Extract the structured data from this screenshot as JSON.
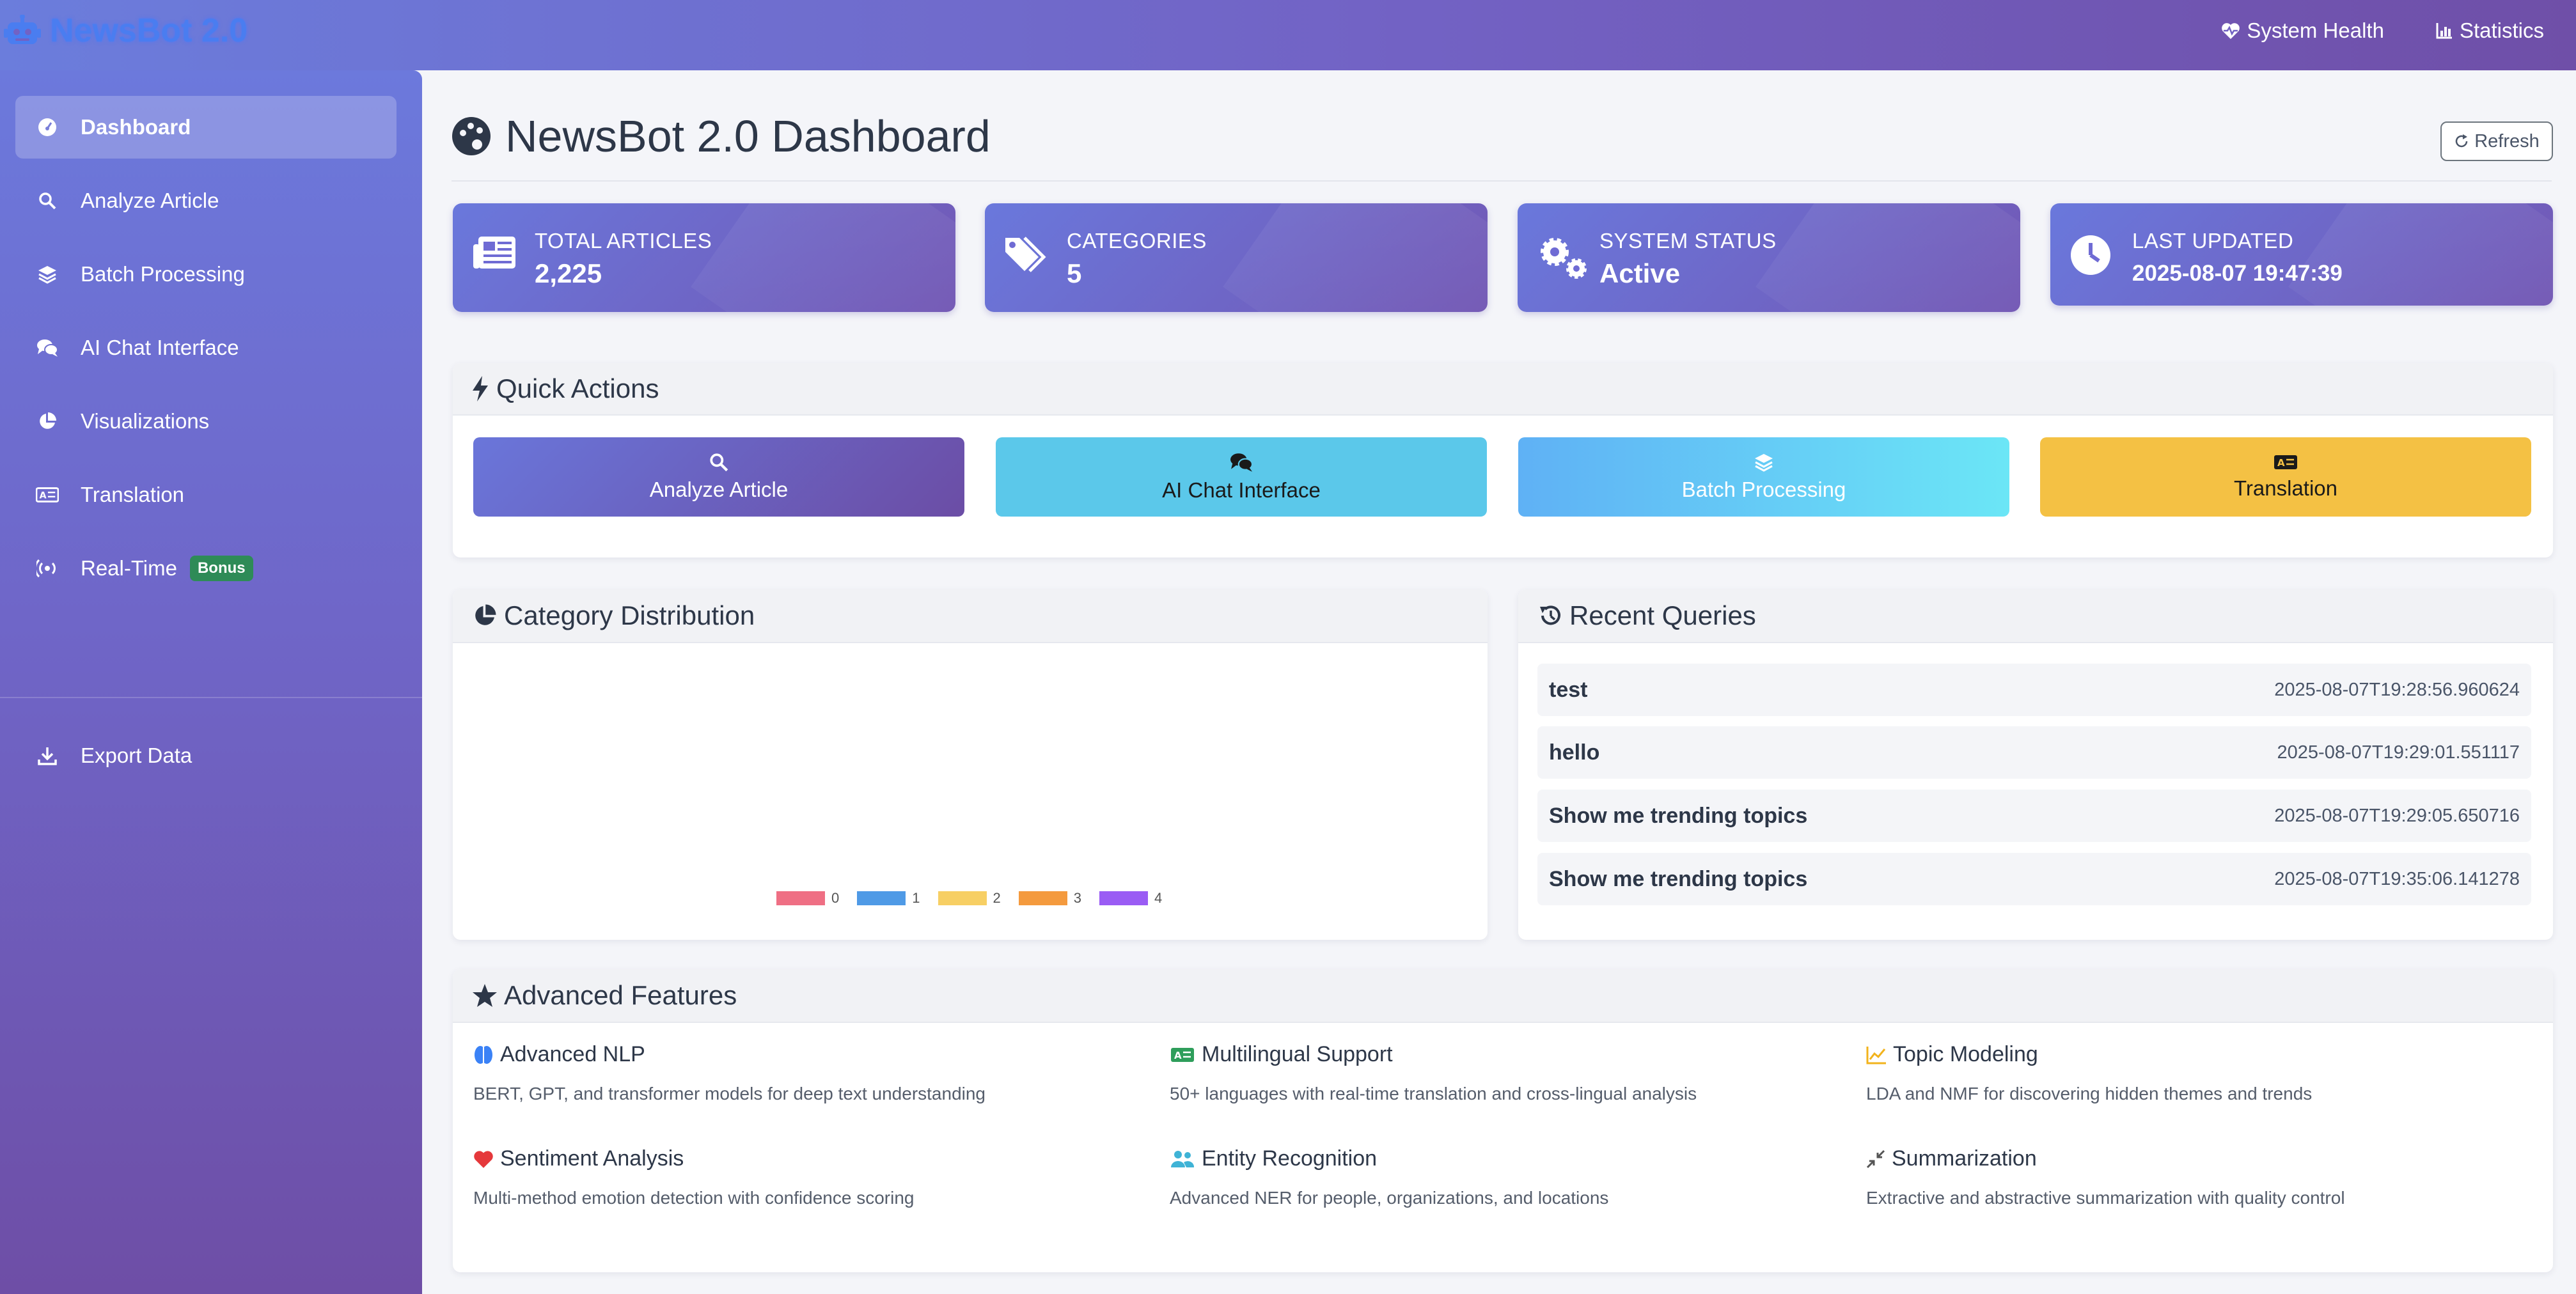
{
  "app": {
    "brand": "NewsBot 2.0"
  },
  "navbar": {
    "links": [
      {
        "label": "System Health",
        "icon": "heart-pulse-icon"
      },
      {
        "label": "Statistics",
        "icon": "bar-chart-icon"
      }
    ]
  },
  "sidebar": {
    "items": [
      {
        "label": "Dashboard",
        "icon": "gauge-icon",
        "active": true
      },
      {
        "label": "Analyze Article",
        "icon": "search-icon"
      },
      {
        "label": "Batch Processing",
        "icon": "layers-icon"
      },
      {
        "label": "AI Chat Interface",
        "icon": "comments-icon"
      },
      {
        "label": "Visualizations",
        "icon": "pie-chart-icon"
      },
      {
        "label": "Translation",
        "icon": "language-icon"
      },
      {
        "label": "Real-Time",
        "icon": "broadcast-icon",
        "badge": "Bonus"
      },
      {
        "label": "Export Data",
        "icon": "download-icon"
      }
    ]
  },
  "page": {
    "title": "NewsBot 2.0 Dashboard",
    "refresh_label": "Refresh"
  },
  "stats": [
    {
      "label": "TOTAL ARTICLES",
      "value": "2,225",
      "icon": "newspaper-icon"
    },
    {
      "label": "CATEGORIES",
      "value": "5",
      "icon": "tags-icon"
    },
    {
      "label": "SYSTEM STATUS",
      "value": "Active",
      "icon": "cogs-icon"
    },
    {
      "label": "LAST UPDATED",
      "value": "2025-08-07 19:47:39",
      "icon": "clock-icon"
    }
  ],
  "quick_actions": {
    "title": "Quick Actions",
    "buttons": [
      {
        "label": "Analyze Article",
        "icon": "search-icon",
        "color": "#6a6fd0"
      },
      {
        "label": "AI Chat Interface",
        "icon": "comments-icon",
        "color": "#5bc8ea"
      },
      {
        "label": "Batch Processing",
        "icon": "layers-icon",
        "color": "#5fc4f4"
      },
      {
        "label": "Translation",
        "icon": "language-icon",
        "color": "#f4c144"
      }
    ]
  },
  "category_distribution": {
    "title": "Category Distribution",
    "legend": [
      {
        "label": "0",
        "color": "#ef6f84"
      },
      {
        "label": "1",
        "color": "#4f9ae6"
      },
      {
        "label": "2",
        "color": "#f7cf64"
      },
      {
        "label": "3",
        "color": "#f49a3e"
      },
      {
        "label": "4",
        "color": "#9a5cf4"
      }
    ]
  },
  "recent_queries": {
    "title": "Recent Queries",
    "rows": [
      {
        "query": "test",
        "time": "2025-08-07T19:28:56.960624"
      },
      {
        "query": "hello",
        "time": "2025-08-07T19:29:01.551117"
      },
      {
        "query": "Show me trending topics",
        "time": "2025-08-07T19:29:05.650716"
      },
      {
        "query": "Show me trending topics",
        "time": "2025-08-07T19:35:06.141278"
      }
    ]
  },
  "advanced_features": {
    "title": "Advanced Features",
    "items": [
      {
        "title": "Advanced NLP",
        "desc": "BERT, GPT, and transformer models for deep text understanding",
        "icon": "brain-icon",
        "icon_color": "#3b82f6"
      },
      {
        "title": "Multilingual Support",
        "desc": "50+ languages with real-time translation and cross-lingual analysis",
        "icon": "language-icon",
        "icon_color": "#2e9e5b"
      },
      {
        "title": "Topic Modeling",
        "desc": "LDA and NMF for discovering hidden themes and trends",
        "icon": "line-chart-icon",
        "icon_color": "#f2b31c"
      },
      {
        "title": "Sentiment Analysis",
        "desc": "Multi-method emotion detection with confidence scoring",
        "icon": "heart-icon",
        "icon_color": "#e5383b"
      },
      {
        "title": "Entity Recognition",
        "desc": "Advanced NER for people, organizations, and locations",
        "icon": "users-icon",
        "icon_color": "#3fb3d6"
      },
      {
        "title": "Summarization",
        "desc": "Extractive and abstractive summarization with quality control",
        "icon": "compress-icon",
        "icon_color": "#555555"
      }
    ]
  }
}
